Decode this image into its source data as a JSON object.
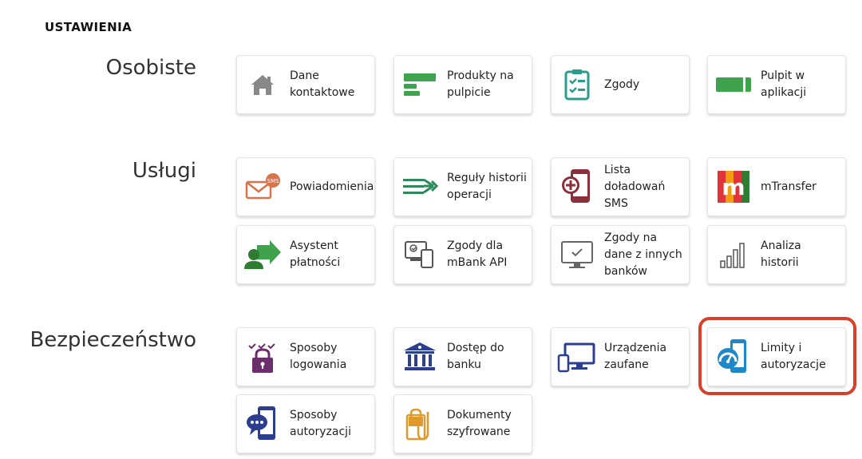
{
  "title": "USTAWIENIA",
  "sections": {
    "personal": {
      "label": "Osobiste",
      "items": [
        {
          "label": "Dane kontaktowe",
          "icon": "home-icon"
        },
        {
          "label": "Produkty na pulpicie",
          "icon": "products-icon"
        },
        {
          "label": "Zgody",
          "icon": "clipboard-checklist-icon"
        },
        {
          "label": "Pulpit w aplikacji",
          "icon": "app-dashboard-icon"
        }
      ]
    },
    "services": {
      "label": "Usługi",
      "items": [
        {
          "label": "Powiadomienia",
          "icon": "sms-envelope-icon"
        },
        {
          "label": "Reguły historii operacji",
          "icon": "rules-arrows-icon"
        },
        {
          "label": "Lista doładowań SMS",
          "icon": "phone-topup-icon"
        },
        {
          "label": "mTransfer",
          "icon": "mtransfer-logo-icon"
        },
        {
          "label": "Asystent płatności",
          "icon": "payment-assistant-icon"
        },
        {
          "label": "Zgody dla mBank API",
          "icon": "api-devices-icon"
        },
        {
          "label": "Zgody na dane z innych banków",
          "icon": "monitor-check-icon"
        },
        {
          "label": "Analiza historii",
          "icon": "bar-chart-icon"
        }
      ]
    },
    "security": {
      "label": "Bezpieczeństwo",
      "items": [
        {
          "label": "Sposoby logowania",
          "icon": "padlock-icon"
        },
        {
          "label": "Dostęp do banku",
          "icon": "bank-building-icon"
        },
        {
          "label": "Urządzenia zaufane",
          "icon": "trusted-devices-icon"
        },
        {
          "label": "Limity i autoryzacje",
          "icon": "phone-gauge-icon"
        },
        {
          "label": "Sposoby autoryzacji",
          "icon": "phone-chat-icon"
        },
        {
          "label": "Dokumenty szyfrowane",
          "icon": "encrypted-documents-icon"
        }
      ]
    }
  },
  "colors": {
    "green": "#3fa34d",
    "teal": "#2a9d8f",
    "highlight": "#d8402c",
    "navy": "#2c3e8f",
    "purple": "#6b2d6b"
  }
}
